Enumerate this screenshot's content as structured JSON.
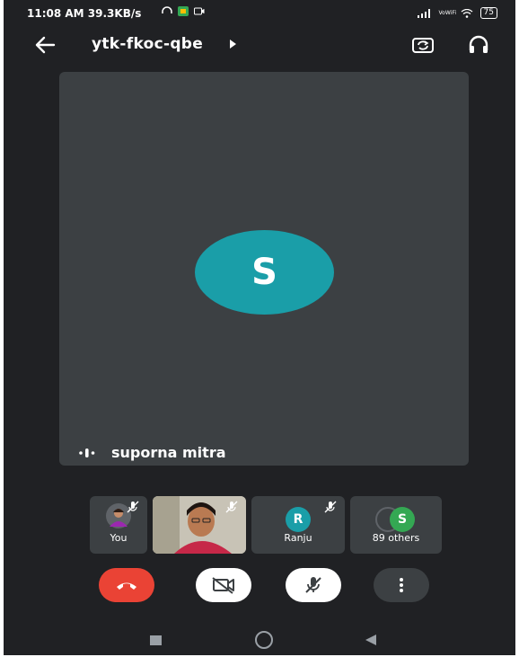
{
  "status_bar": {
    "time": "11:08 AM",
    "net_speed": "39.3KB/s",
    "network": "VoWiFi",
    "battery": "75"
  },
  "header": {
    "meeting_code": "ytk-fkoc-qbe"
  },
  "main_tile": {
    "avatar_letter": "S",
    "avatar_color": "#1a9ea8",
    "speaker_name": "suporna mitra"
  },
  "participants": [
    {
      "label": "You",
      "muted": true
    },
    {
      "label": "",
      "muted": true
    },
    {
      "label": "Ranju",
      "initial": "R",
      "avatar_color": "#1a9ea8",
      "muted": true
    },
    {
      "label": "89 others",
      "initial": "S",
      "avatar_color": "#34a853"
    }
  ],
  "controls": {
    "end_call_color": "#ea4335"
  }
}
